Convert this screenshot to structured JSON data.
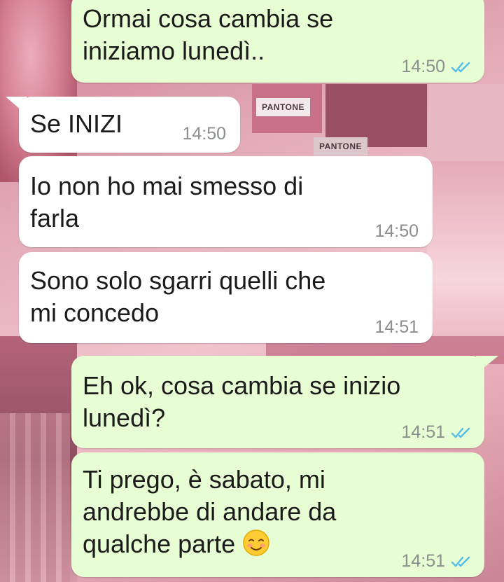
{
  "wallpaper": {
    "pantone_label_1": "PANTONE",
    "pantone_label_2": "PANTONE"
  },
  "messages": [
    {
      "direction": "outgoing",
      "text": "Ormai cosa cambia se\niniziamo lunedì..",
      "time": "14:50",
      "status_icon": "double-check-icon"
    },
    {
      "direction": "incoming",
      "text": "Se INIZI",
      "time": "14:50"
    },
    {
      "direction": "incoming",
      "text": "Io non ho mai smesso di\nfarla",
      "time": "14:50"
    },
    {
      "direction": "incoming",
      "text": "Sono solo sgarri quelli che\nmi concedo",
      "time": "14:51"
    },
    {
      "direction": "outgoing",
      "text": "Eh ok, cosa cambia se inizio\nlunedì?",
      "time": "14:51",
      "status_icon": "double-check-icon"
    },
    {
      "direction": "outgoing",
      "text": "Ti prego, è sabato, mi\nandrebbe di andare da\nqualche parte",
      "emoji": "smiling-face-icon",
      "time": "14:51",
      "status_icon": "double-check-icon"
    }
  ],
  "colors": {
    "outgoing_bubble": "#e7fdd3",
    "incoming_bubble": "#ffffff",
    "read_check": "#53bdeb",
    "timestamp": "#8a8f8b"
  }
}
